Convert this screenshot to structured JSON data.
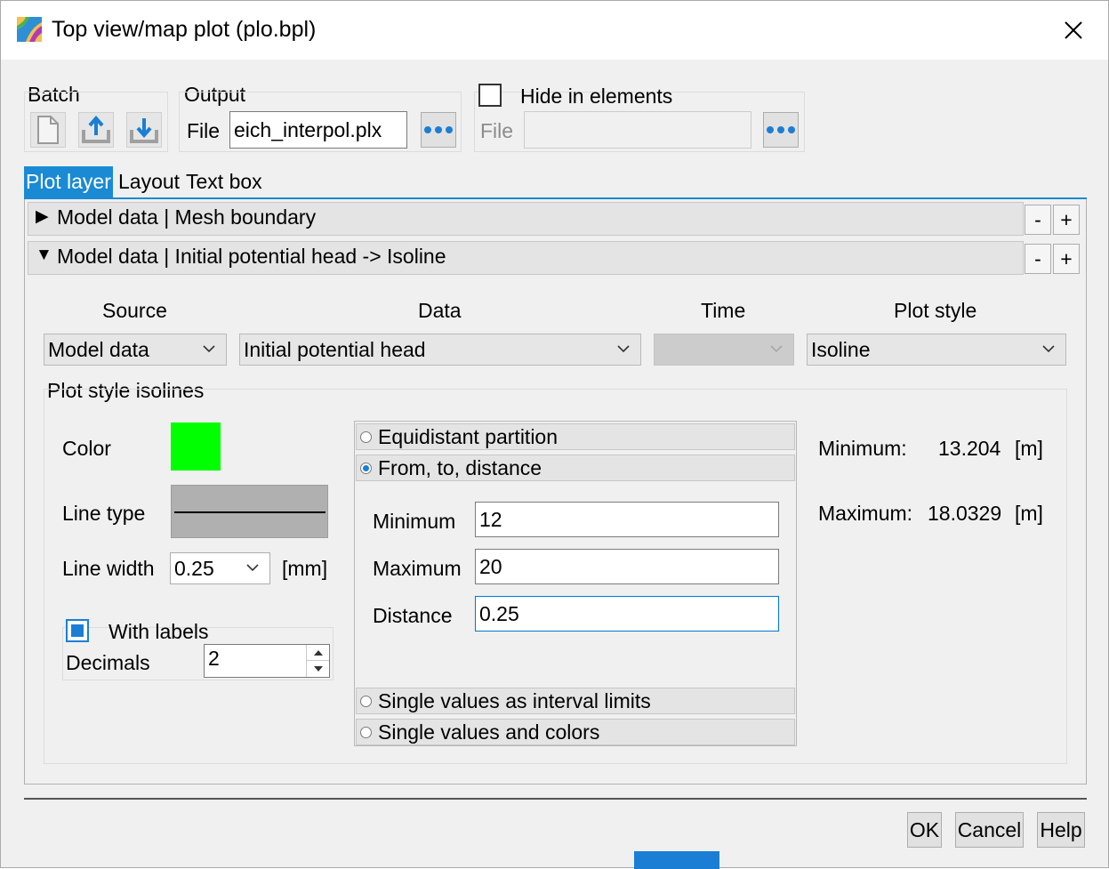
{
  "window": {
    "title": "Top view/map plot (plo.bpl)",
    "icons": {
      "app": "map-plot-icon",
      "close": "close-icon"
    }
  },
  "batch": {
    "label": "Batch",
    "icons": [
      "new-file-icon",
      "upload-icon",
      "download-icon"
    ]
  },
  "output": {
    "label": "Output",
    "file_label": "File",
    "file_value": "eich_interpol.plx"
  },
  "hide": {
    "label": "Hide in elements",
    "checked": false,
    "file_label": "File",
    "file_value": ""
  },
  "tabs": [
    {
      "label": "Plot layer",
      "active": true
    },
    {
      "label": "Layout",
      "active": false
    },
    {
      "label": "Text box",
      "active": false
    }
  ],
  "layers": [
    {
      "label": "Model data | Mesh boundary",
      "expanded": false,
      "minus": "-",
      "plus": "+"
    },
    {
      "label": "Model data | Initial potential head -> Isoline",
      "expanded": true,
      "minus": "-",
      "plus": "+"
    }
  ],
  "columns": {
    "source": "Source",
    "data": "Data",
    "time": "Time",
    "plot_style": "Plot style"
  },
  "selects": {
    "source": "Model data",
    "data": "Initial potential head",
    "time": "",
    "plot_style": "Isoline"
  },
  "isolines": {
    "group_label": "Plot style isolines",
    "color_label": "Color",
    "color_value": "#00ff00",
    "line_type_label": "Line type",
    "line_width_label": "Line width",
    "line_width_value": "0.25",
    "line_width_unit": "[mm]",
    "with_labels_label": "With labels",
    "with_labels_checked": true,
    "decimals_label": "Decimals",
    "decimals_value": "2"
  },
  "partition": {
    "options": [
      {
        "label": "Equidistant partition",
        "checked": false
      },
      {
        "label": "From, to, distance",
        "checked": true
      },
      {
        "label": "Single values as interval limits",
        "checked": false
      },
      {
        "label": "Single values and colors",
        "checked": false
      }
    ],
    "minimum_label": "Minimum",
    "minimum_value": "12",
    "maximum_label": "Maximum",
    "maximum_value": "20",
    "distance_label": "Distance",
    "distance_value": "0.25"
  },
  "range": {
    "min_label": "Minimum:",
    "min_value": "13.204",
    "max_label": "Maximum:",
    "max_value": "18.0329",
    "unit": "[m]"
  },
  "buttons": {
    "ok": "OK",
    "cancel": "Cancel",
    "help": "Help"
  },
  "colors": {
    "accent": "#1a8ad4",
    "isoline_color": "#00ff00"
  }
}
